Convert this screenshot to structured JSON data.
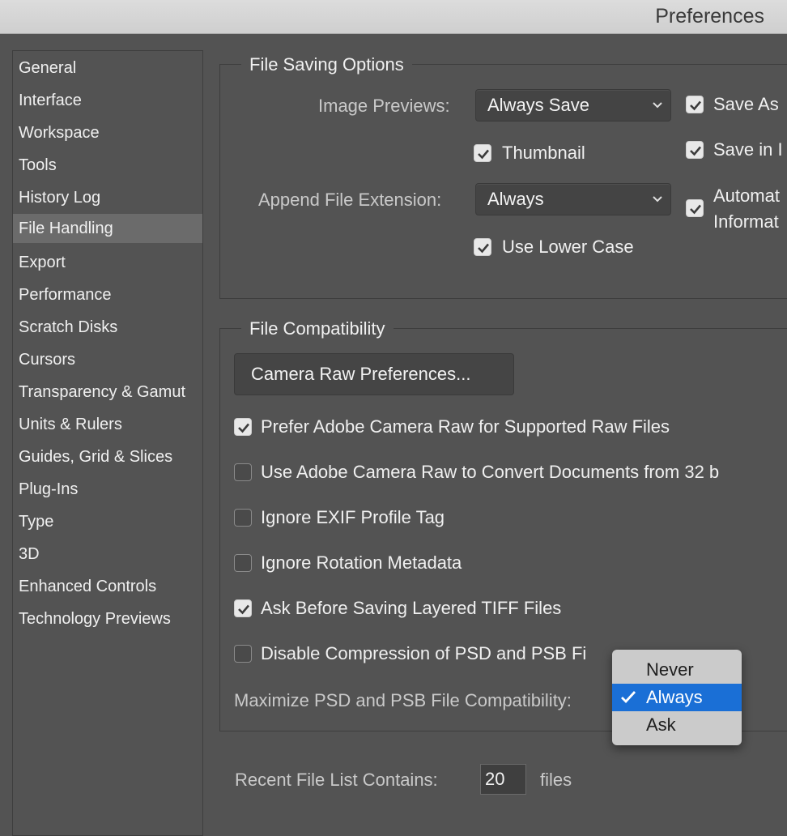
{
  "window": {
    "title": "Preferences"
  },
  "sidebar": {
    "items": [
      {
        "label": "General"
      },
      {
        "label": "Interface"
      },
      {
        "label": "Workspace"
      },
      {
        "label": "Tools"
      },
      {
        "label": "History Log"
      },
      {
        "label": "File Handling"
      },
      {
        "label": "Export"
      },
      {
        "label": "Performance"
      },
      {
        "label": "Scratch Disks"
      },
      {
        "label": "Cursors"
      },
      {
        "label": "Transparency & Gamut"
      },
      {
        "label": "Units & Rulers"
      },
      {
        "label": "Guides, Grid & Slices"
      },
      {
        "label": "Plug-Ins"
      },
      {
        "label": "Type"
      },
      {
        "label": "3D"
      },
      {
        "label": "Enhanced Controls"
      },
      {
        "label": "Technology Previews"
      }
    ],
    "selected": "File Handling"
  },
  "file_saving": {
    "title": "File Saving Options",
    "image_previews_label": "Image Previews:",
    "image_previews_value": "Always Save",
    "thumbnail_label": "Thumbnail",
    "thumbnail_checked": true,
    "append_ext_label": "Append File Extension:",
    "append_ext_value": "Always",
    "lower_case_label": "Use Lower Case",
    "lower_case_checked": true,
    "save_as_label": "Save As",
    "save_as_checked": true,
    "save_in_label": "Save in I",
    "save_in_checked": true,
    "auto_line1": "Automat",
    "auto_line2": "Informat",
    "auto_checked": true
  },
  "file_compat": {
    "title": "File Compatibility",
    "camera_raw_button": "Camera Raw Preferences...",
    "options": [
      {
        "label": "Prefer Adobe Camera Raw for Supported Raw Files",
        "checked": true
      },
      {
        "label": "Use Adobe Camera Raw to Convert Documents from 32 b",
        "checked": false
      },
      {
        "label": "Ignore EXIF Profile Tag",
        "checked": false
      },
      {
        "label": "Ignore Rotation Metadata",
        "checked": false
      },
      {
        "label": "Ask Before Saving Layered TIFF Files",
        "checked": true
      },
      {
        "label": "Disable Compression of PSD and PSB Fi",
        "checked": false
      }
    ],
    "maximize_label": "Maximize PSD and PSB File Compatibility:"
  },
  "dropdown_menu": {
    "options": [
      "Never",
      "Always",
      "Ask"
    ],
    "selected": "Always"
  },
  "recent_files": {
    "label": "Recent File List Contains:",
    "value": "20",
    "suffix": "files"
  }
}
